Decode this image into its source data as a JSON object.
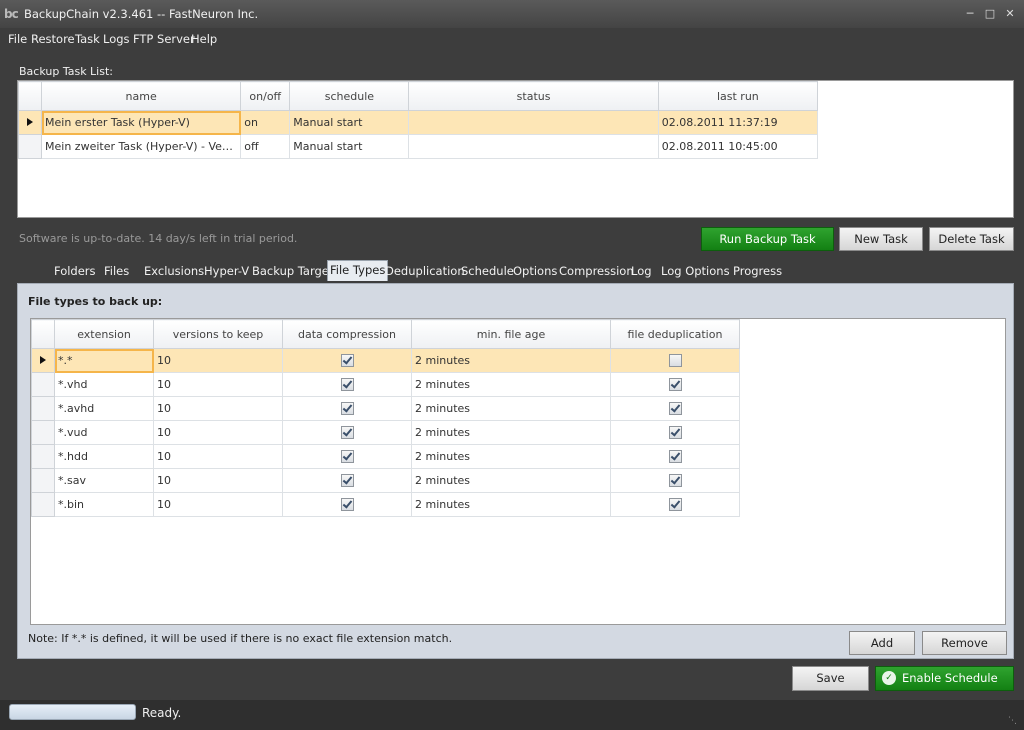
{
  "window": {
    "title": "BackupChain v2.3.461 -- FastNeuron Inc.",
    "logo_text": "bc"
  },
  "menu": [
    "File",
    "Restore",
    "Task",
    "Logs",
    "FTP Server",
    "Help"
  ],
  "task_list": {
    "label": "Backup Task List:",
    "columns": [
      "name",
      "on/off",
      "schedule",
      "status",
      "last run"
    ],
    "rows": [
      {
        "name": "Mein erster Task (Hyper-V)",
        "onoff": "on",
        "schedule": "Manual start",
        "status": "",
        "last_run": "02.08.2011 11:37:19"
      },
      {
        "name": "Mein zweiter Task (Hyper-V) - Versch…",
        "onoff": "off",
        "schedule": "Manual start",
        "status": "",
        "last_run": "02.08.2011 10:45:00"
      }
    ]
  },
  "trial_message": "Software is up-to-date. 14 day/s left in trial period.",
  "buttons": {
    "run": "Run Backup Task",
    "new": "New Task",
    "delete": "Delete Task",
    "add": "Add",
    "remove": "Remove",
    "save": "Save",
    "enable_schedule": "Enable Schedule"
  },
  "tabs": [
    "Folders",
    "Files",
    "Exclusions",
    "Hyper-V",
    "Backup Target",
    "File Types",
    "Deduplication",
    "Schedule",
    "Options",
    "Compression",
    "Log",
    "Log Options",
    "Progress"
  ],
  "active_tab": "File Types",
  "file_types": {
    "label": "File types to back up:",
    "columns": [
      "extension",
      "versions to keep",
      "data compression",
      "min. file age",
      "file deduplication"
    ],
    "rows": [
      {
        "ext": "*.*",
        "versions": "10",
        "compression": true,
        "age": "2 minutes",
        "dedup": false
      },
      {
        "ext": "*.vhd",
        "versions": "10",
        "compression": true,
        "age": "2 minutes",
        "dedup": true
      },
      {
        "ext": "*.avhd",
        "versions": "10",
        "compression": true,
        "age": "2 minutes",
        "dedup": true
      },
      {
        "ext": "*.vud",
        "versions": "10",
        "compression": true,
        "age": "2 minutes",
        "dedup": true
      },
      {
        "ext": "*.hdd",
        "versions": "10",
        "compression": true,
        "age": "2 minutes",
        "dedup": true
      },
      {
        "ext": "*.sav",
        "versions": "10",
        "compression": true,
        "age": "2 minutes",
        "dedup": true
      },
      {
        "ext": "*.bin",
        "versions": "10",
        "compression": true,
        "age": "2 minutes",
        "dedup": true
      }
    ],
    "note": "Note: If *.* is defined, it will be used if there is no exact file extension match."
  },
  "status": {
    "text": "Ready."
  },
  "icons": {
    "minimize": "minimize-icon",
    "maximize": "maximize-icon",
    "close": "close-icon",
    "schedule": "clock-check-icon",
    "row_pointer": "row-pointer-icon"
  }
}
